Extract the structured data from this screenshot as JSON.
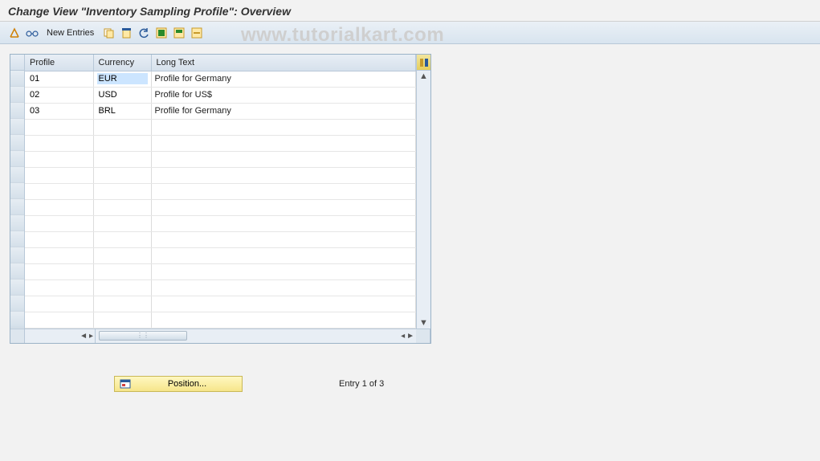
{
  "title": "Change View \"Inventory Sampling Profile\": Overview",
  "toolbar": {
    "new_entries": "New Entries"
  },
  "watermark": "www.tutorialkart.com",
  "table": {
    "headers": {
      "profile": "Profile",
      "currency": "Currency",
      "longtext": "Long Text"
    },
    "rows": [
      {
        "profile": "01",
        "currency": "EUR",
        "longtext": "Profile for Germany"
      },
      {
        "profile": "02",
        "currency": "USD",
        "longtext": "Profile for US$"
      },
      {
        "profile": "03",
        "currency": "BRL",
        "longtext": "Profile for Germany"
      }
    ],
    "empty_rows": 13
  },
  "footer": {
    "position_label": "Position...",
    "entry_text": "Entry 1 of 3"
  }
}
